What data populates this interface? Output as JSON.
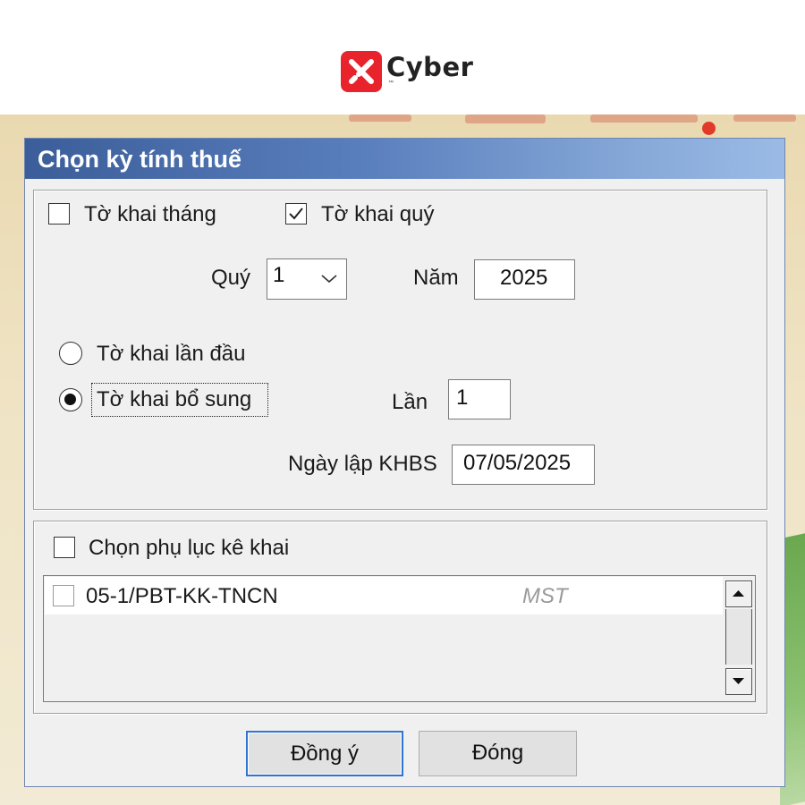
{
  "brand": {
    "name": "Cyber",
    "tm": "™"
  },
  "dialog": {
    "title": "Chọn kỳ tính thuế",
    "monthly": {
      "label": "Tờ khai tháng",
      "checked": false
    },
    "quarterly": {
      "label": "Tờ khai quý",
      "checked": true
    },
    "quarter": {
      "label": "Quý",
      "value": "1"
    },
    "year": {
      "label": "Năm",
      "value": "2025"
    },
    "first_declaration": {
      "label": "Tờ khai lần đầu",
      "selected": false
    },
    "supplementary": {
      "label": "Tờ khai bổ sung",
      "selected": true
    },
    "times": {
      "label": "Lần",
      "value": "1"
    },
    "khbs_date": {
      "label": "Ngày lập KHBS",
      "value": "07/05/2025"
    },
    "appendix": {
      "label": "Chọn phụ lục kê khai",
      "checked": false,
      "items": [
        {
          "code": "05-1/PBT-KK-TNCN",
          "hint": "MST",
          "checked": false
        }
      ]
    },
    "buttons": {
      "ok": "Đồng ý",
      "close": "Đóng"
    }
  },
  "colors": {
    "title_bar": "#3b5e9a",
    "brand_red": "#e8232c",
    "default_button_border": "#2e74d2"
  }
}
